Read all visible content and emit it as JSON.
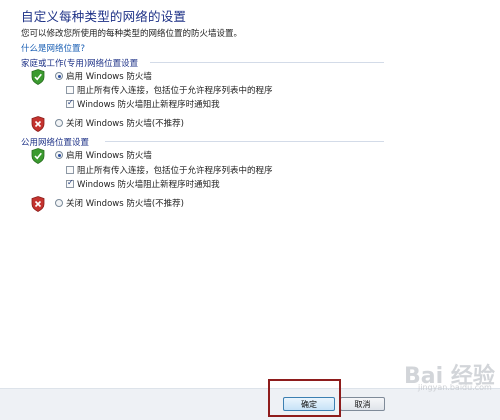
{
  "header": {
    "title": "自定义每种类型的网络的设置",
    "description": "您可以修改您所使用的每种类型的网络位置的防火墙设置。",
    "help_link": "什么是网络位置?"
  },
  "home_section": {
    "title": "家庭或工作(专用)网络位置设置",
    "enable_label": "启用 Windows 防火墙",
    "block_all_label": "阻止所有传入连接，包括位于允许程序列表中的程序",
    "notify_label": "Windows 防火墙阻止新程序时通知我",
    "disable_label": "关闭 Windows 防火墙(不推荐)",
    "enable_selected": true,
    "block_all_checked": false,
    "notify_checked": true
  },
  "public_section": {
    "title": "公用网络位置设置",
    "enable_label": "启用 Windows 防火墙",
    "block_all_label": "阻止所有传入连接，包括位于允许程序列表中的程序",
    "notify_label": "Windows 防火墙阻止新程序时通知我",
    "disable_label": "关闭 Windows 防火墙(不推荐)",
    "enable_selected": true,
    "block_all_checked": false,
    "notify_checked": true
  },
  "footer": {
    "ok_label": "确定",
    "cancel_label": "取消"
  },
  "watermark": {
    "brand": "Bai 经验",
    "url": "jingyan.baidu.com"
  },
  "colors": {
    "title_blue": "#1e3287",
    "link_blue": "#1a5fb4",
    "shield_green": "#3b9a2f",
    "shield_red": "#c4332f",
    "highlight_red": "#8e1c1c"
  }
}
